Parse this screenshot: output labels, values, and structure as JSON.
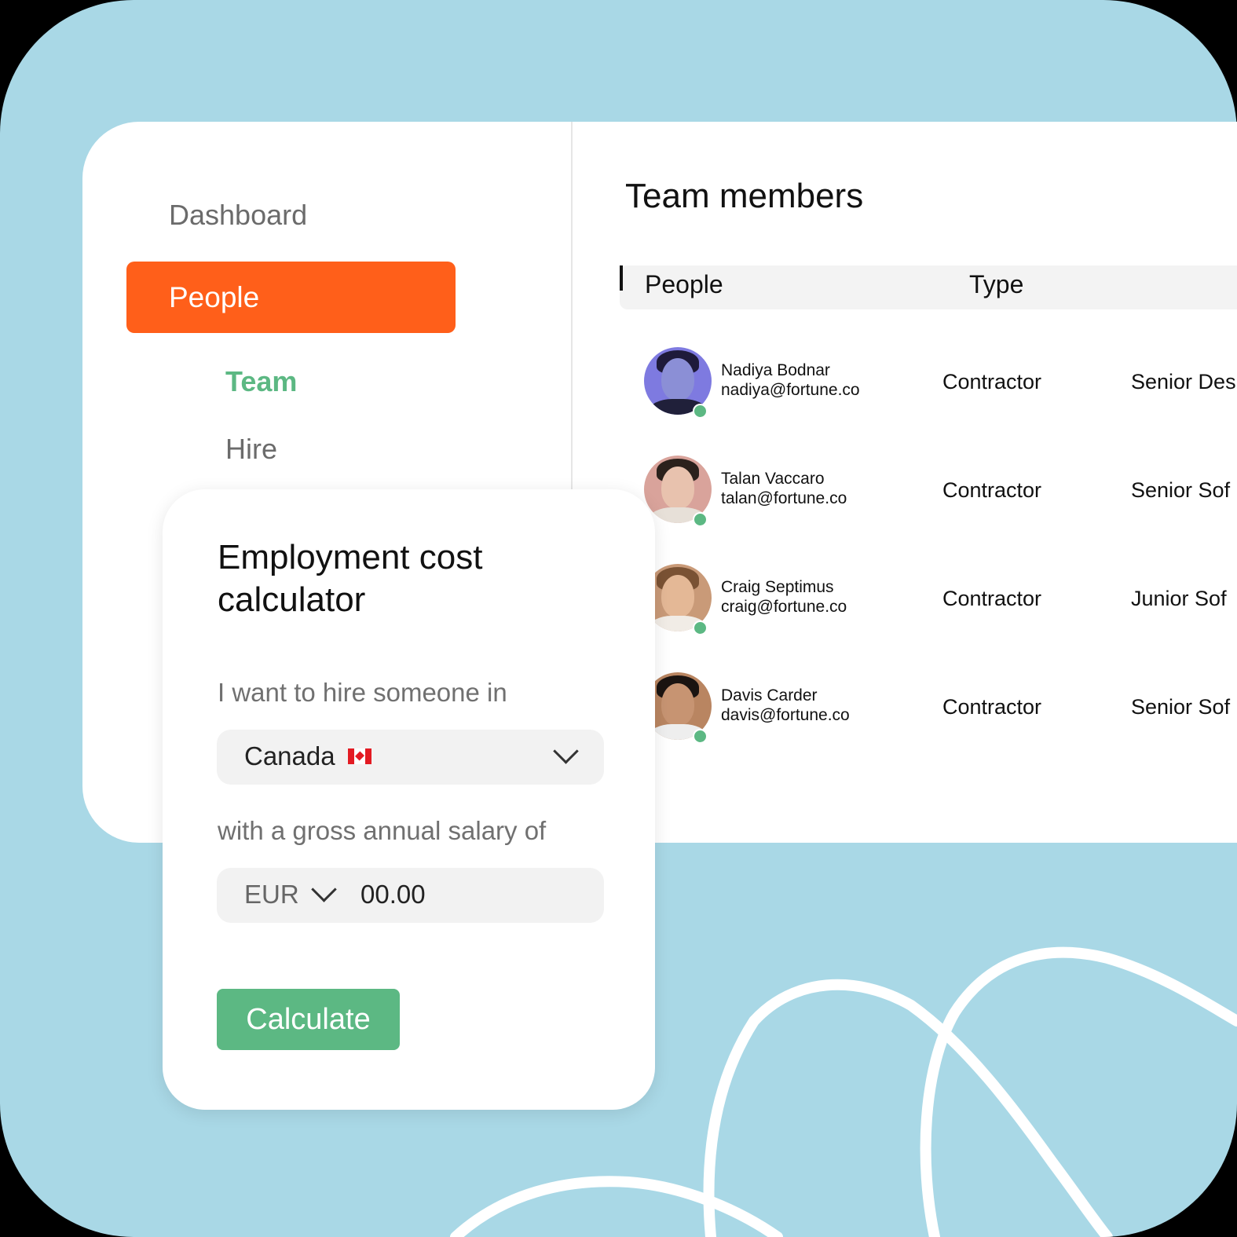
{
  "sidebar": {
    "items": [
      {
        "label": "Dashboard"
      },
      {
        "label": "People"
      },
      {
        "label": "Team"
      },
      {
        "label": "Hire"
      }
    ]
  },
  "main": {
    "title": "Team members",
    "table": {
      "columns": [
        "People",
        "Type"
      ],
      "rows": [
        {
          "name": "Nadiya Bodnar",
          "email": "nadiya@fortune.co",
          "type": "Contractor",
          "role": "Senior Des"
        },
        {
          "name": "Talan Vaccaro",
          "email": "talan@fortune.co",
          "type": "Contractor",
          "role": "Senior Sof"
        },
        {
          "name": "Craig Septimus",
          "email": "craig@fortune.co",
          "type": "Contractor",
          "role": "Junior Sof"
        },
        {
          "name": "Davis Carder",
          "email": "davis@fortune.co",
          "type": "Contractor",
          "role": "Senior Sof"
        }
      ]
    }
  },
  "calculator": {
    "title": "Employment cost calculator",
    "country_label": "I want to hire someone in",
    "country_value": "Canada",
    "country_flag_icon": "canada-flag-icon",
    "salary_label": "with a gross annual salary of",
    "currency": "EUR",
    "amount": "00.00",
    "button_label": "Calculate"
  },
  "colors": {
    "background": "#a9d8e6",
    "accent_orange": "#ff5f1a",
    "accent_green": "#5cb883",
    "status_online": "#5cb883"
  }
}
